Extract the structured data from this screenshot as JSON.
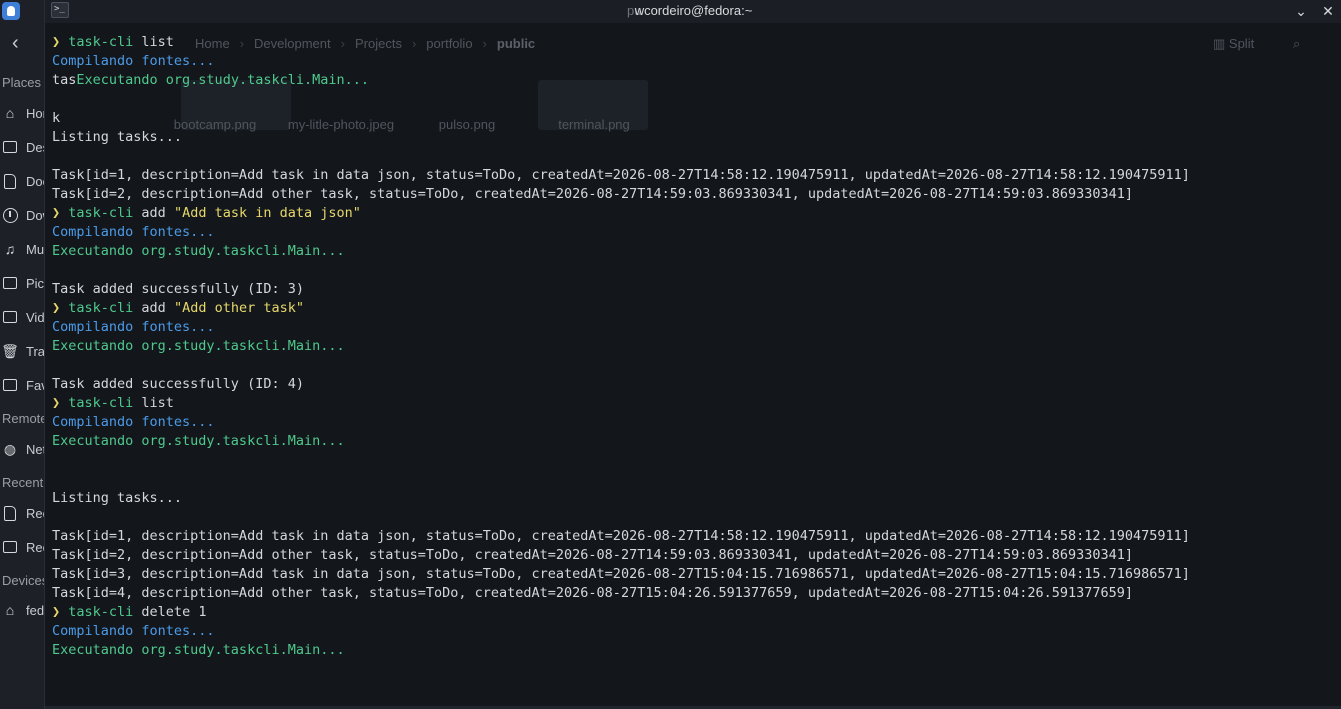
{
  "file_manager": {
    "sections": {
      "places": "Places",
      "remote": "Remote",
      "recent": "Recent",
      "devices": "Devices"
    },
    "items": [
      {
        "label": "Home",
        "icon": "home-icon"
      },
      {
        "label": "Desktop",
        "icon": "desktop-icon"
      },
      {
        "label": "Documents",
        "icon": "documents-icon"
      },
      {
        "label": "Downloads",
        "icon": "downloads-icon"
      },
      {
        "label": "Music",
        "icon": "music-icon"
      },
      {
        "label": "Pictures",
        "icon": "pictures-icon"
      },
      {
        "label": "Videos",
        "icon": "videos-icon"
      },
      {
        "label": "Trash",
        "icon": "trash-icon"
      },
      {
        "label": "Favorites",
        "icon": "folder-icon"
      },
      {
        "label": "Network",
        "icon": "network-icon"
      },
      {
        "label": "Recent Files",
        "icon": "recent-files-icon"
      },
      {
        "label": "Recent Locations",
        "icon": "recent-locations-icon"
      },
      {
        "label": "fedora",
        "icon": "drive-icon"
      }
    ],
    "breadcrumb": [
      "Home",
      "Development",
      "Projects",
      "portfolio",
      "public"
    ],
    "split_label": "Split",
    "files": [
      "bootcamp.png",
      "my-litle-photo.jpeg",
      "pulso.png",
      "terminal.png"
    ]
  },
  "terminal": {
    "title": "wcordeiro@fedora:~",
    "ghost_title": "pu",
    "lines": [
      [
        {
          "t": "❯ ",
          "c": "prompt"
        },
        {
          "t": "task-cli",
          "c": "cmd"
        },
        {
          "t": " list",
          "c": ""
        }
      ],
      [
        {
          "t": "Compilando fontes...",
          "c": "blue"
        }
      ],
      [
        {
          "t": "tas",
          "c": ""
        },
        {
          "t": "Executando org.study.taskcli.Main...",
          "c": "green"
        }
      ],
      [],
      [
        {
          "t": "k",
          "c": ""
        }
      ],
      [
        {
          "t": "Listing tasks...",
          "c": ""
        }
      ],
      [],
      [
        {
          "t": "Task[id=1, description=Add task in data json, status=ToDo, createdAt=2026-08-27T14:58:12.190475911, updatedAt=2026-08-27T14:58:12.190475911]",
          "c": ""
        }
      ],
      [
        {
          "t": "Task[id=2, description=Add other task, status=ToDo, createdAt=2026-08-27T14:59:03.869330341, updatedAt=2026-08-27T14:59:03.869330341]",
          "c": ""
        }
      ],
      [
        {
          "t": "❯ ",
          "c": "prompt"
        },
        {
          "t": "task-cli",
          "c": "cmd"
        },
        {
          "t": " add ",
          "c": ""
        },
        {
          "t": "\"Add task in data json\"",
          "c": "str"
        }
      ],
      [
        {
          "t": "Compilando fontes...",
          "c": "blue"
        }
      ],
      [
        {
          "t": "Executando org.study.taskcli.Main...",
          "c": "green"
        }
      ],
      [],
      [
        {
          "t": "Task added successfully (ID: 3)",
          "c": ""
        }
      ],
      [
        {
          "t": "❯ ",
          "c": "prompt"
        },
        {
          "t": "task-cli",
          "c": "cmd"
        },
        {
          "t": " add ",
          "c": ""
        },
        {
          "t": "\"Add other task\"",
          "c": "str"
        }
      ],
      [
        {
          "t": "Compilando fontes...",
          "c": "blue"
        }
      ],
      [
        {
          "t": "Executando org.study.taskcli.Main...",
          "c": "green"
        }
      ],
      [],
      [
        {
          "t": "Task added successfully (ID: 4)",
          "c": ""
        }
      ],
      [
        {
          "t": "❯ ",
          "c": "prompt"
        },
        {
          "t": "task-cli",
          "c": "cmd"
        },
        {
          "t": " list",
          "c": ""
        }
      ],
      [
        {
          "t": "Compilando fontes...",
          "c": "blue"
        }
      ],
      [
        {
          "t": "Executando org.study.taskcli.Main...",
          "c": "green"
        }
      ],
      [],
      [],
      [
        {
          "t": "Listing tasks...",
          "c": ""
        }
      ],
      [],
      [
        {
          "t": "Task[id=1, description=Add task in data json, status=ToDo, createdAt=2026-08-27T14:58:12.190475911, updatedAt=2026-08-27T14:58:12.190475911]",
          "c": ""
        }
      ],
      [
        {
          "t": "Task[id=2, description=Add other task, status=ToDo, createdAt=2026-08-27T14:59:03.869330341, updatedAt=2026-08-27T14:59:03.869330341]",
          "c": ""
        }
      ],
      [
        {
          "t": "Task[id=3, description=Add task in data json, status=ToDo, createdAt=2026-08-27T15:04:15.716986571, updatedAt=2026-08-27T15:04:15.716986571]",
          "c": ""
        }
      ],
      [
        {
          "t": "Task[id=4, description=Add other task, status=ToDo, createdAt=2026-08-27T15:04:26.591377659, updatedAt=2026-08-27T15:04:26.591377659]",
          "c": ""
        }
      ],
      [
        {
          "t": "❯ ",
          "c": "prompt"
        },
        {
          "t": "task-cli",
          "c": "cmd"
        },
        {
          "t": " delete 1",
          "c": ""
        }
      ],
      [
        {
          "t": "Compilando fontes...",
          "c": "blue"
        }
      ],
      [
        {
          "t": "Executando org.study.taskcli.Main...",
          "c": "green"
        }
      ]
    ]
  },
  "colors": {
    "prompt": "#e6d86a",
    "command": "#4fc98c",
    "compiling": "#4c9be8",
    "background": "#13171d"
  }
}
